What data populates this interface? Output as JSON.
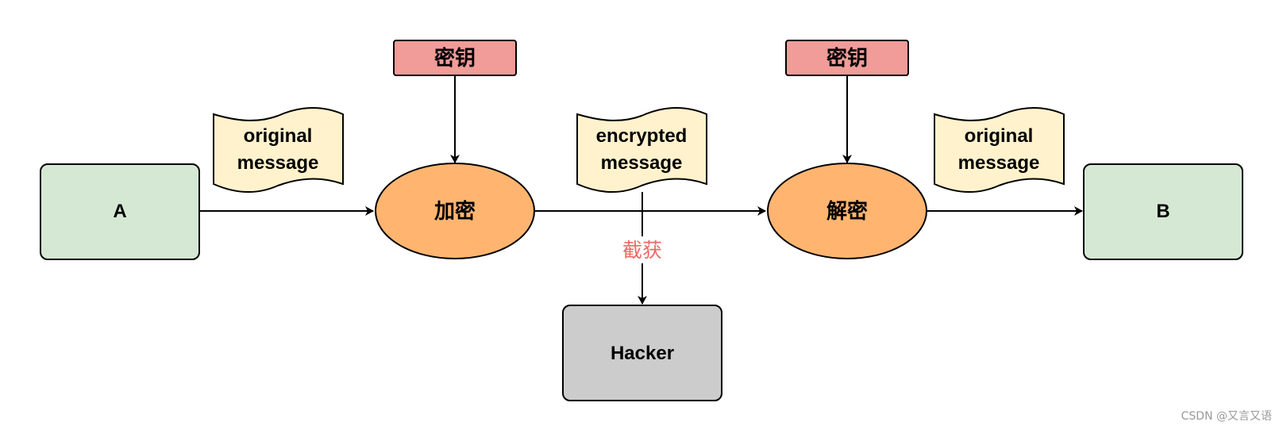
{
  "colors": {
    "endpoint_fill": "#d5e8d4",
    "process_fill": "#ffb570",
    "key_fill": "#f19c99",
    "message_fill": "#fff2cc",
    "hacker_fill": "#cccccc",
    "intercept_text": "#ea6b66",
    "stroke": "#000000"
  },
  "nodes": {
    "sender": {
      "label": "A"
    },
    "receiver": {
      "label": "B"
    },
    "encrypt": {
      "label": "加密"
    },
    "decrypt": {
      "label": "解密"
    },
    "encrypt_key": {
      "label": "密钥"
    },
    "decrypt_key": {
      "label": "密钥"
    },
    "hacker": {
      "label": "Hacker"
    }
  },
  "messages": {
    "plaintext_in": {
      "lines": [
        "original",
        "message"
      ]
    },
    "ciphertext": {
      "lines": [
        "encrypted",
        "message"
      ]
    },
    "plaintext_out": {
      "lines": [
        "original",
        "message"
      ]
    }
  },
  "edges": [
    {
      "from": "A",
      "to": "加密"
    },
    {
      "from": "密钥",
      "to": "加密"
    },
    {
      "from": "加密",
      "to": "解密"
    },
    {
      "from": "密钥",
      "to": "解密"
    },
    {
      "from": "解密",
      "to": "B"
    },
    {
      "from": "encrypted message",
      "to": "Hacker",
      "label": "截获"
    }
  ],
  "intercept_label": "截获",
  "watermark": "CSDN @又言又语"
}
